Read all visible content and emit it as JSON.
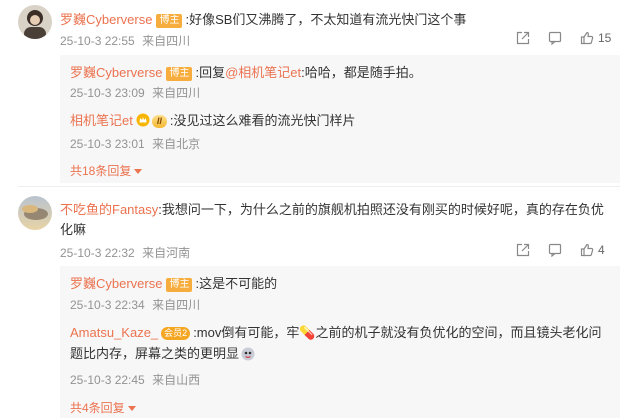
{
  "comments": [
    {
      "user": "罗巍Cyberverse",
      "badge": "博主",
      "text": ":好像SB们又沸腾了，不太知道有流光快门这个事",
      "time": "25-10-3 22:55",
      "location": "来自四川",
      "likes": "15",
      "replies": [
        {
          "user": "罗巍Cyberverse",
          "badge": "博主",
          "text_pre": ":回复",
          "mention": "@相机笔记et",
          "text_post": ":哈哈，都是随手拍。",
          "time": "25-10-3 23:09",
          "location": "来自四川"
        },
        {
          "user": "相机笔记et",
          "vip": "II",
          "text": ":没见过这么难看的流光快门样片",
          "time": "25-10-3 23:01",
          "location": "来自北京"
        }
      ],
      "more_label": "共18条回复"
    },
    {
      "user": "不吃鱼的Fantasy",
      "text": ":我想问一下，为什么之前的旗舰机拍照还没有刚买的时候好呢，真的存在负优化嘛",
      "time": "25-10-3 22:32",
      "location": "来自河南",
      "likes": "4",
      "replies": [
        {
          "user": "罗巍Cyberverse",
          "badge": "博主",
          "text": ":这是不可能的",
          "time": "25-10-3 22:34",
          "location": "来自四川"
        },
        {
          "user": "Amatsu_Kaze_",
          "badge": "会员2",
          "text": ":mov倒有可能，牢💊之前的机子就没有负优化的空间，而且镜头老化问题比内存，屏幕之类的更明显",
          "time": "25-10-3 22:45",
          "location": "来自山西"
        }
      ],
      "more_label": "共4条回复"
    }
  ]
}
